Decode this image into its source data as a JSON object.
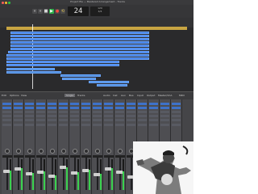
{
  "window": {
    "title": "Project file — Mastered Arrangement - Tracks",
    "lcd_position": "24",
    "lcd_tempo_line1": "120",
    "lcd_tempo_line2": "4/4"
  },
  "tracks": {
    "region_color": "#3d7be0",
    "ruler_color": "#c8a542"
  },
  "mixer": {
    "tabs": [
      "Edit",
      "Options",
      "View",
      "Sends on Faders",
      "Single",
      "Tracks",
      "All",
      "Audio",
      "Inst",
      "Aux",
      "Bus",
      "Input",
      "Output",
      "Master/VCA",
      "MIDI"
    ],
    "channel_count": 16,
    "meter_levels": [
      0.62,
      0.7,
      0.55,
      0.6,
      0.48,
      0.75,
      0.58,
      0.66,
      0.52,
      0.71,
      0.6,
      0.45,
      0.68,
      0.5,
      0.57,
      0.63
    ]
  },
  "icons": [
    "close-dot-icon",
    "minimize-dot-icon",
    "zoom-dot-icon",
    "rewind-icon",
    "forward-icon",
    "stop-icon",
    "play-icon",
    "record-icon",
    "cycle-icon"
  ],
  "colors": {
    "close": "#ff5f57",
    "minimize": "#febc2e",
    "zoom": "#28c840",
    "meter": "#3ad14e",
    "plugin_slot": "#3e72c9"
  }
}
